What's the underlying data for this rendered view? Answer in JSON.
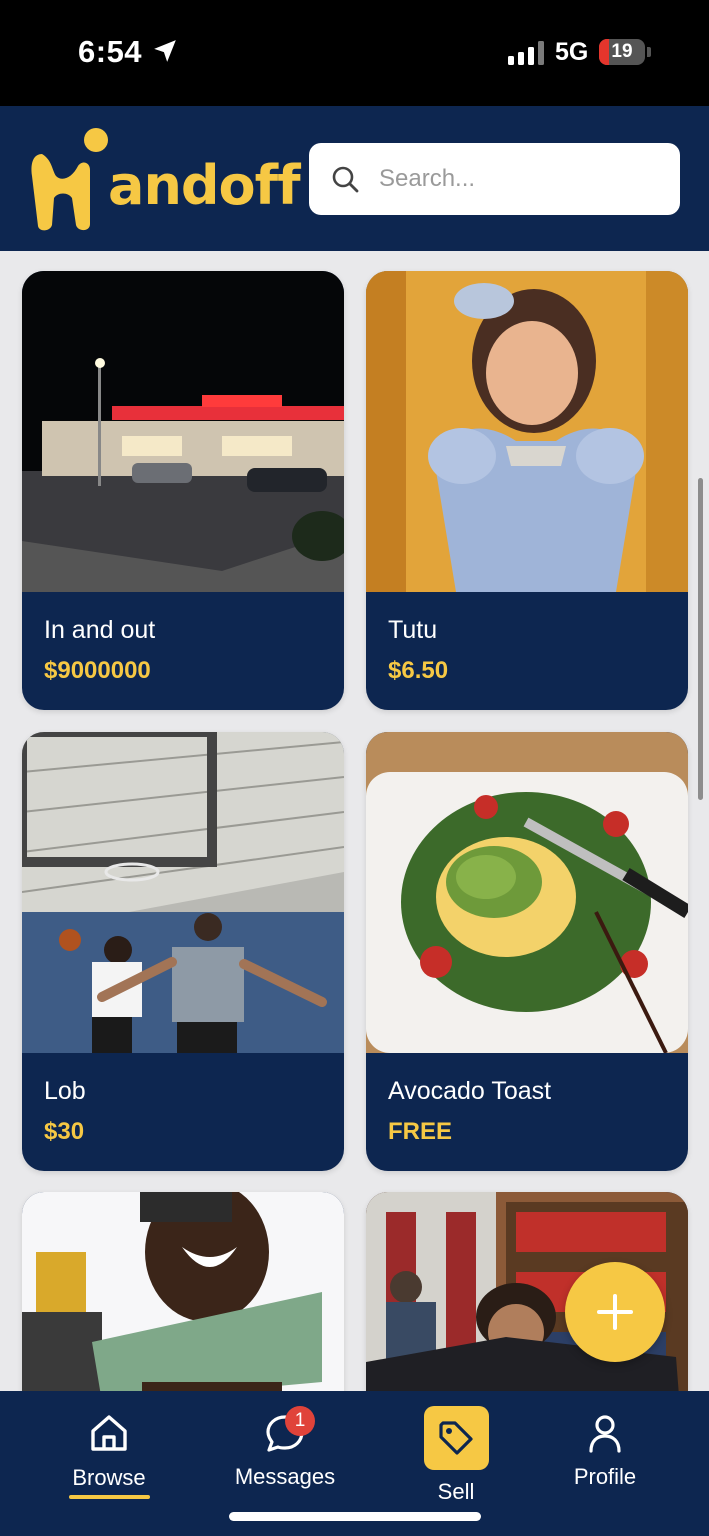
{
  "status_bar": {
    "time": "6:54",
    "network": "5G",
    "battery": "19"
  },
  "header": {
    "brand": "andoff",
    "search_placeholder": "Search..."
  },
  "listings": [
    {
      "title": "In and out",
      "price": "$9000000"
    },
    {
      "title": "Tutu",
      "price": "$6.50"
    },
    {
      "title": "Lob",
      "price": "$30"
    },
    {
      "title": "Avocado Toast",
      "price": "FREE"
    }
  ],
  "tabs": {
    "browse": "Browse",
    "messages": "Messages",
    "sell": "Sell",
    "profile": "Profile"
  },
  "messages_badge": "1",
  "colors": {
    "navy": "#0d2650",
    "accent": "#f6c844",
    "badge": "#e0433a"
  }
}
